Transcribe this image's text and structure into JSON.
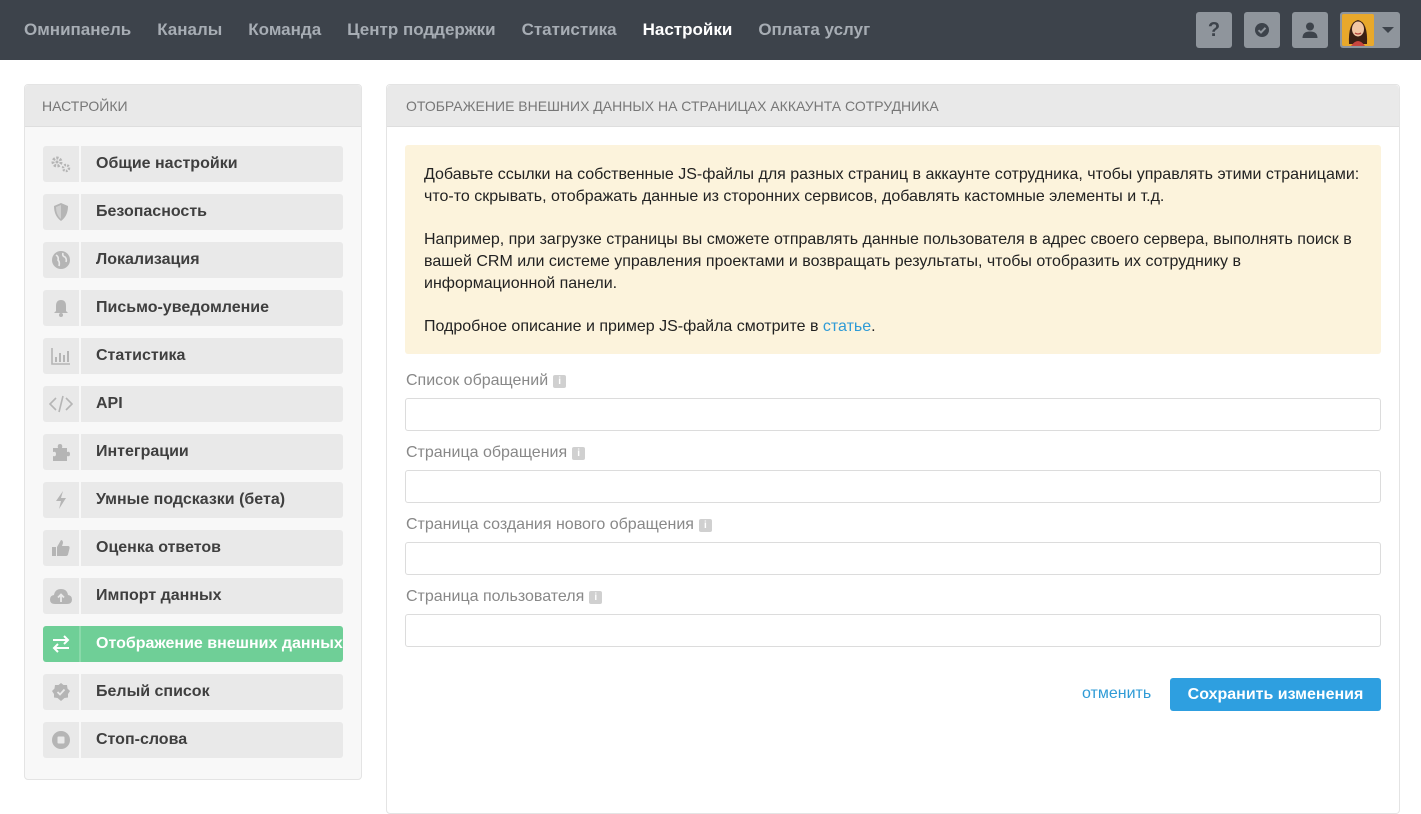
{
  "nav": {
    "items": [
      {
        "label": "Омнипанель"
      },
      {
        "label": "Каналы"
      },
      {
        "label": "Команда"
      },
      {
        "label": "Центр поддержки"
      },
      {
        "label": "Статистика"
      },
      {
        "label": "Настройки",
        "active": true
      },
      {
        "label": "Оплата услуг"
      }
    ],
    "help_label": "?"
  },
  "sidebar": {
    "title": "НАСТРОЙКИ",
    "items": [
      {
        "label": "Общие настройки",
        "icon": "gears-icon"
      },
      {
        "label": "Безопасность",
        "icon": "shield-icon"
      },
      {
        "label": "Локализация",
        "icon": "globe-icon"
      },
      {
        "label": "Письмо-уведомление",
        "icon": "bell-icon"
      },
      {
        "label": "Статистика",
        "icon": "bar-chart-icon"
      },
      {
        "label": "API",
        "icon": "code-icon"
      },
      {
        "label": "Интеграции",
        "icon": "puzzle-icon"
      },
      {
        "label": "Умные подсказки (бета)",
        "icon": "lightning-icon"
      },
      {
        "label": "Оценка ответов",
        "icon": "thumbs-up-icon"
      },
      {
        "label": "Импорт данных",
        "icon": "cloud-upload-icon"
      },
      {
        "label": "Отображение внешних данных",
        "icon": "swap-arrows-icon",
        "active": true
      },
      {
        "label": "Белый список",
        "icon": "check-badge-icon"
      },
      {
        "label": "Стоп-слова",
        "icon": "stop-icon"
      }
    ]
  },
  "main": {
    "title": "ОТОБРАЖЕНИЕ ВНЕШНИХ ДАННЫХ НА СТРАНИЦАХ АККАУНТА СОТРУДНИКА",
    "notice": {
      "p1": "Добавьте ссылки на собственные JS-файлы для разных страниц в аккаунте сотрудника, чтобы управлять этими страницами: что-то скрывать, отображать данные из сторонних сервисов, добавлять кастомные элементы и т.д.",
      "p2": "Например, при загрузке страницы вы сможете отправлять данные пользователя в адрес своего сервера, выполнять поиск в вашей CRM или системе управления проектами и возвращать результаты, чтобы отобразить их сотруднику в информационной панели.",
      "p3_prefix": "Подробное описание и пример JS-файла смотрите в ",
      "p3_link": "статье",
      "p3_suffix": "."
    },
    "fields": [
      {
        "label": "Список обращений",
        "value": "",
        "placeholder": ""
      },
      {
        "label": "Страница обращения",
        "value": "",
        "placeholder": ""
      },
      {
        "label": "Страница создания нового обращения",
        "value": "",
        "placeholder": ""
      },
      {
        "label": "Страница пользователя",
        "value": "",
        "placeholder": ""
      }
    ],
    "info_glyph": "i",
    "cancel_label": "отменить",
    "save_label": "Сохранить изменения"
  },
  "colors": {
    "topbar": "#3d434b",
    "accent_green": "#6fcf97",
    "link_blue": "#2f9bd6",
    "primary_button": "#2e9fe0",
    "notice_bg": "#fcf3dc"
  }
}
